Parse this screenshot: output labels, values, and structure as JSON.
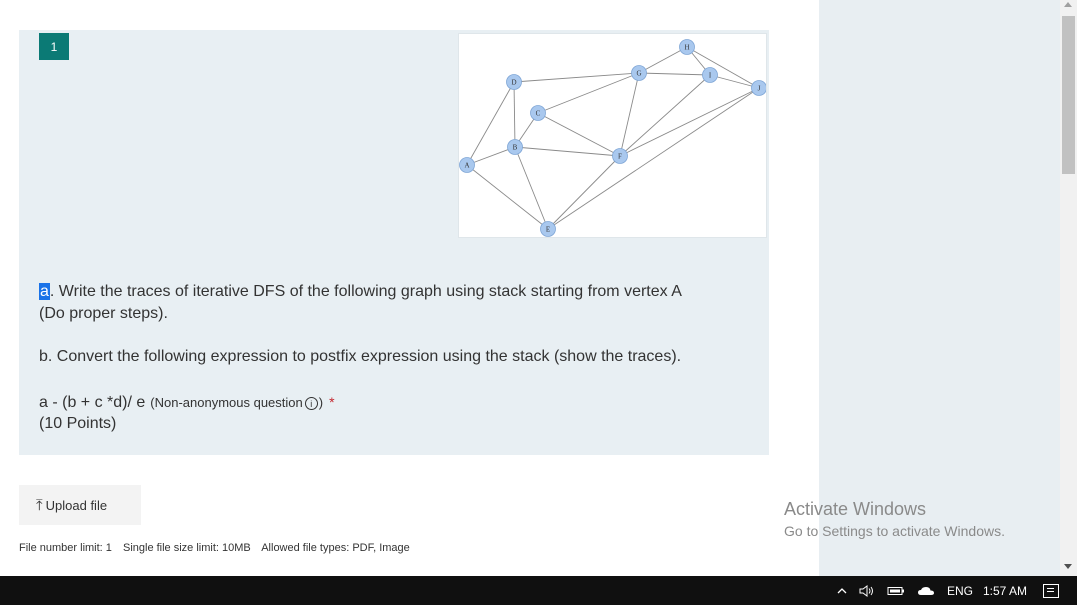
{
  "question": {
    "number": "1",
    "part_a_letter": "a",
    "part_a_text": ". Write the traces  of  iterative DFS of the following graph using stack starting from vertex A",
    "part_a_text_line2": "(Do proper steps).",
    "part_b_text": "b. Convert the following expression to postfix expression using the stack (show the traces).",
    "expression": "a - (b + c *d)/ e",
    "meta_prefix": "(Non-anonymous question",
    "meta_suffix": ")",
    "info_icon": "info-icon",
    "required_mark": "*",
    "points": "(10 Points)"
  },
  "graph": {
    "nodes": {
      "A": "A",
      "B": "B",
      "C": "C",
      "D": "D",
      "E": "E",
      "F": "F",
      "G": "G",
      "H": "H",
      "I": "I",
      "J": "J"
    },
    "colors": {
      "node_fill": "#a9c8ee",
      "node_stroke": "#7fa6d6",
      "edge": "#888888"
    }
  },
  "upload": {
    "label": "Upload file",
    "icon": "upload-icon"
  },
  "file_limits": {
    "number_limit": "File number limit: 1",
    "size_limit": "Single file size limit: 10MB",
    "types": "Allowed file types: PDF, Image"
  },
  "watermark": {
    "title": "Activate Windows",
    "subtitle": "Go to Settings to activate Windows."
  },
  "taskbar": {
    "language": "ENG",
    "time": "1:57 AM",
    "icons": [
      "chevron-up-icon",
      "speaker-icon",
      "battery-icon",
      "cloud-icon",
      "notification-icon"
    ]
  },
  "colors": {
    "accent_teal": "#0b7a75",
    "card_bg": "#e8eff3",
    "required_red": "#c4262e",
    "highlight_blue": "#1a73e8"
  }
}
